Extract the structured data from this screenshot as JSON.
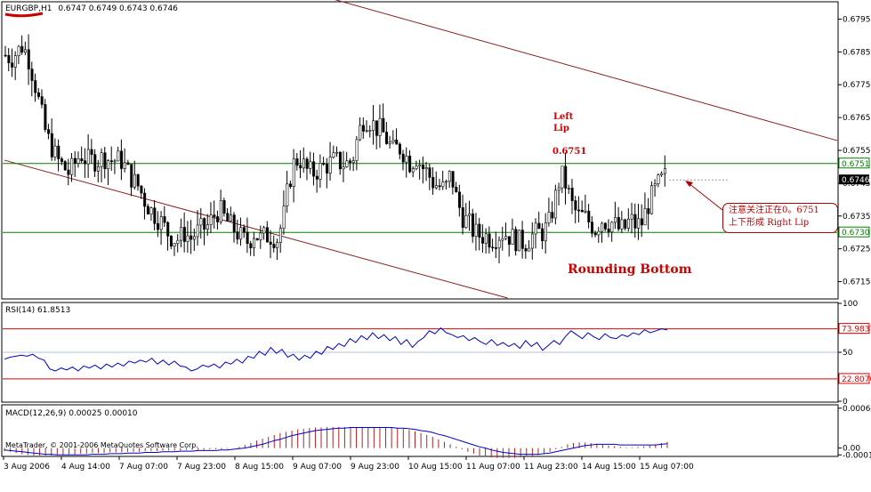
{
  "header": {
    "symbol": "EURGBP,H1",
    "ohlc": "0.6747 0.6749 0.6743 0.6746"
  },
  "annotations": {
    "left_lip_line1": "Left",
    "left_lip_line2": "Lip",
    "level_label": "0.6751",
    "pattern_title": "Rounding Bottom",
    "callout_line1": "注意关注正在0。6751",
    "callout_line2": "上下形成 Right Lip",
    "watermark": "MetaTrader, © 2001-2006 MetaQuotes Software Corp."
  },
  "colors": {
    "candles": "#000000",
    "channel": "#8b1a1a",
    "support_resistance": "#008000",
    "rsi_line": "#0000cc",
    "rsi_levels": "#dd0000",
    "macd_hist": "#b22222",
    "macd_signal": "#0000cc",
    "annotation_red": "#cc0000"
  },
  "chart_data": [
    {
      "type": "candlestick",
      "title": "EURGBP,H1",
      "ylim": [
        0.671,
        0.68
      ],
      "y_ticks": [
        "0.6795",
        "0.6785",
        "0.6775",
        "0.6765",
        "0.6755",
        "0.6745",
        "0.6735",
        "0.6725",
        "0.6715"
      ],
      "x_ticks": [
        "3 Aug 2006",
        "4 Aug 14:00",
        "7 Aug 07:00",
        "7 Aug 23:00",
        "8 Aug 15:00",
        "9 Aug 07:00",
        "9 Aug 23:00",
        "10 Aug 15:00",
        "11 Aug 07:00",
        "11 Aug 23:00",
        "14 Aug 15:00",
        "15 Aug 07:00"
      ],
      "close_path": [
        0.6784,
        0.6783,
        0.6785,
        0.6787,
        0.6783,
        0.6776,
        0.6768,
        0.676,
        0.6756,
        0.6752,
        0.675,
        0.6748,
        0.6751,
        0.6754,
        0.6752,
        0.6752,
        0.6752,
        0.6753,
        0.6752,
        0.6752,
        0.6752,
        0.6749,
        0.6746,
        0.6744,
        0.674,
        0.6737,
        0.6735,
        0.6733,
        0.673,
        0.6728,
        0.6728,
        0.673,
        0.6728,
        0.673,
        0.6731,
        0.6732,
        0.6735,
        0.6737,
        0.6734,
        0.6732,
        0.673,
        0.6728,
        0.6727,
        0.673,
        0.6728,
        0.6729,
        0.6729,
        0.6728,
        0.6734,
        0.6745,
        0.6752,
        0.6752,
        0.6749,
        0.6748,
        0.6749,
        0.675,
        0.6751,
        0.6752,
        0.6751,
        0.6751,
        0.6752,
        0.676,
        0.6765,
        0.6764,
        0.6762,
        0.6761,
        0.6758,
        0.6755,
        0.6756,
        0.6754,
        0.6751,
        0.6753,
        0.675,
        0.6748,
        0.6745,
        0.6744,
        0.6743,
        0.6748,
        0.674,
        0.6735,
        0.6733,
        0.673,
        0.6729,
        0.6729,
        0.6728,
        0.6729,
        0.673,
        0.6729,
        0.6728,
        0.6727,
        0.6727,
        0.6729,
        0.673,
        0.673,
        0.6733,
        0.674,
        0.6748,
        0.6744,
        0.6738,
        0.6735,
        0.6735,
        0.6733,
        0.6731,
        0.6734,
        0.6733,
        0.6733,
        0.6731,
        0.6731,
        0.6734,
        0.6732,
        0.6733,
        0.6738,
        0.6742,
        0.6745,
        0.6747
      ],
      "series_candles_count": 200,
      "horizontal_levels": [
        {
          "name": "resistance",
          "value": 0.6751,
          "label": "0.6751"
        },
        {
          "name": "support",
          "value": 0.673,
          "label": "0.6730"
        }
      ],
      "current_price": {
        "value": 0.6746,
        "label": "0.6746"
      },
      "channel_upper": {
        "start": {
          "x_index": 95,
          "y": 0.6801
        },
        "end": {
          "x_index": 240,
          "y": 0.6758
        }
      },
      "channel_lower": {
        "start": {
          "x_index": 0,
          "y": 0.6752
        },
        "end": {
          "x_index": 145,
          "y": 0.671
        }
      }
    },
    {
      "type": "line",
      "title": "RSI(14) 61.8513",
      "ylim": [
        0,
        100
      ],
      "y_ticks": [
        "100",
        "73.9837",
        "50",
        "22.8070",
        "0"
      ],
      "levels": [
        73.9837,
        22.807
      ],
      "mid_level": 50,
      "values": [
        43,
        45,
        46,
        47,
        46,
        48,
        44,
        42,
        33,
        31,
        34,
        32,
        35,
        31,
        36,
        34,
        37,
        33,
        38,
        35,
        39,
        36,
        41,
        39,
        42,
        40,
        44,
        38,
        42,
        37,
        41,
        36,
        35,
        31,
        33,
        37,
        35,
        38,
        34,
        40,
        38,
        43,
        39,
        46,
        44,
        51,
        47,
        55,
        49,
        53,
        45,
        48,
        42,
        47,
        44,
        51,
        48,
        56,
        53,
        59,
        56,
        64,
        60,
        67,
        63,
        70,
        64,
        68,
        62,
        66,
        58,
        63,
        55,
        61,
        65,
        72,
        69,
        75,
        70,
        68,
        65,
        67,
        62,
        65,
        61,
        58,
        63,
        57,
        60,
        56,
        59,
        54,
        62,
        56,
        60,
        52,
        57,
        62,
        58,
        66,
        72,
        68,
        64,
        70,
        66,
        63,
        69,
        65,
        64,
        68,
        66,
        70,
        68,
        73,
        70,
        72,
        74,
        73
      ]
    },
    {
      "type": "bar",
      "title": "MACD(12,26,9) 0.00025 0.00010",
      "ylim": [
        -0.00012,
        0.00068
      ],
      "y_ticks": [
        "0.00064",
        "0.00",
        "-0.00011"
      ],
      "histogram": [
        -5e-05,
        -6e-05,
        -8e-05,
        -0.0001,
        -0.00011,
        -0.00012,
        -0.00012,
        -0.00012,
        -0.00012,
        -0.00011,
        -0.00011,
        -0.0001,
        -0.0001,
        -9e-05,
        -9e-05,
        -8e-05,
        -8e-05,
        -8e-05,
        -7e-05,
        -7e-05,
        -7e-05,
        -6e-05,
        -6e-05,
        -6e-05,
        -5e-05,
        -5e-05,
        -5e-05,
        -4e-05,
        -4e-05,
        -4e-05,
        -4e-05,
        -3e-05,
        -3e-05,
        -3e-05,
        -3e-05,
        -2e-05,
        -2e-05,
        -2e-05,
        -1e-05,
        0,
        2e-05,
        5e-05,
        8e-05,
        0.00012,
        0.00015,
        0.00018,
        0.00021,
        0.00024,
        0.00026,
        0.00028,
        0.0003,
        0.00031,
        0.00032,
        0.00033,
        0.00033,
        0.00034,
        0.00034,
        0.00034,
        0.00034,
        0.00034,
        0.00034,
        0.00034,
        0.00034,
        0.00034,
        0.00034,
        0.00034,
        0.00033,
        0.00032,
        0.00031,
        0.00029,
        0.00027,
        0.00024,
        0.00021,
        0.00018,
        0.00014,
        0.0001,
        6e-05,
        2e-05,
        -2e-05,
        -6e-05,
        -9e-05,
        -0.00012,
        -0.00014,
        -0.00015,
        -0.00016,
        -0.00016,
        -0.00016,
        -0.00016,
        -0.00015,
        -0.00014,
        -0.00013,
        -0.00011,
        -9e-05,
        -6e-05,
        -2e-05,
        2e-05,
        6e-05,
        8e-05,
        9e-05,
        9e-05,
        8e-05,
        7e-05,
        5e-05,
        4e-05,
        3e-05,
        2e-05,
        1e-05,
        1e-05,
        2e-05,
        3e-05,
        4e-05,
        6e-05,
        8e-05,
        0.0001
      ],
      "signal": [
        -3e-05,
        -4e-05,
        -5e-05,
        -6e-05,
        -7e-05,
        -8e-05,
        -9e-05,
        -0.0001,
        -0.0001,
        -0.00011,
        -0.00011,
        -0.00011,
        -0.00011,
        -0.00011,
        -0.00011,
        -0.0001,
        -0.0001,
        -0.0001,
        -9e-05,
        -9e-05,
        -9e-05,
        -8e-05,
        -8e-05,
        -8e-05,
        -7e-05,
        -7e-05,
        -7e-05,
        -6e-05,
        -6e-05,
        -6e-05,
        -5e-05,
        -5e-05,
        -5e-05,
        -4e-05,
        -4e-05,
        -4e-05,
        -4e-05,
        -3e-05,
        -3e-05,
        -2e-05,
        -1e-05,
        0,
        2e-05,
        4e-05,
        6e-05,
        9e-05,
        0.00012,
        0.00014,
        0.00017,
        0.0002,
        0.00022,
        0.00024,
        0.00026,
        0.00028,
        0.00029,
        0.0003,
        0.00031,
        0.00032,
        0.00032,
        0.00033,
        0.00033,
        0.00033,
        0.00033,
        0.00033,
        0.00033,
        0.00033,
        0.00033,
        0.00032,
        0.00032,
        0.00031,
        0.0003,
        0.00028,
        0.00027,
        0.00025,
        0.00022,
        0.0002,
        0.00017,
        0.00014,
        0.00011,
        8e-05,
        5e-05,
        2e-05,
        0,
        -3e-05,
        -5e-05,
        -7e-05,
        -8e-05,
        -9e-05,
        -0.0001,
        -0.0001,
        -0.0001,
        -0.0001,
        -9e-05,
        -8e-05,
        -6e-05,
        -4e-05,
        -2e-05,
        0,
        2e-05,
        4e-05,
        5e-05,
        6e-05,
        6e-05,
        6e-05,
        6e-05,
        5e-05,
        5e-05,
        5e-05,
        5e-05,
        5e-05,
        5e-05,
        5e-05,
        6e-05,
        7e-05
      ]
    }
  ]
}
